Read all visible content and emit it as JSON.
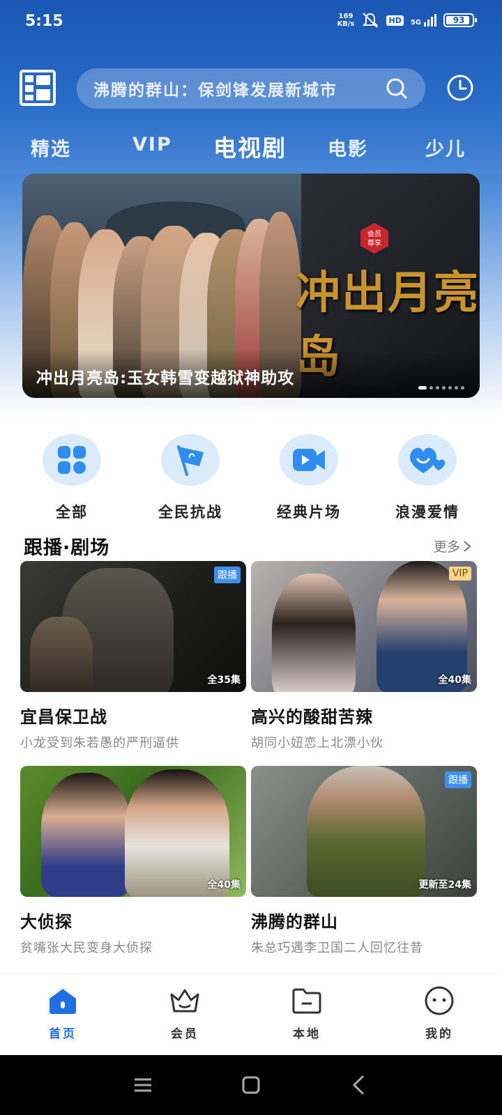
{
  "status_bar": {
    "time": "5:15",
    "speed_value": "169",
    "speed_unit": "KB/s",
    "hd": "HD",
    "network": "5G",
    "battery": "93",
    "battery_level": 0.93
  },
  "search": {
    "placeholder": "沸腾的群山：保剑锋发展新城市",
    "icon": "search-icon"
  },
  "tabs": [
    {
      "label": "精选",
      "active": false
    },
    {
      "label": "VIP",
      "active": false
    },
    {
      "label": "电视剧",
      "active": true
    },
    {
      "label": "电影",
      "active": false
    },
    {
      "label": "少儿",
      "active": false
    }
  ],
  "banner": {
    "art_title": "冲出月亮岛",
    "seal_text_1": "会员",
    "seal_text_2": "尊享",
    "caption": "冲出月亮岛:玉女韩雪变越狱神助攻",
    "dot_count": 7,
    "active_dot": 0
  },
  "categories": [
    {
      "label": "全部",
      "icon": "grid-icon"
    },
    {
      "label": "全民抗战",
      "icon": "flag-icon"
    },
    {
      "label": "经典片场",
      "icon": "video-camera-icon"
    },
    {
      "label": "浪漫爱情",
      "icon": "heart-icon"
    }
  ],
  "section": {
    "title": "跟播·剧场",
    "more": "更多"
  },
  "cards": [
    {
      "title": "宜昌保卫战",
      "subtitle": "小龙受到朱若愚的严刑逼供",
      "badge": "跟播",
      "episodes": "全35集"
    },
    {
      "title": "高兴的酸甜苦辣",
      "subtitle": "胡同小妞恋上北漂小伙",
      "badge": "VIP",
      "episodes": "全40集"
    },
    {
      "title": "大侦探",
      "subtitle": "贫嘴张大民变身大侦探",
      "badge": "",
      "episodes": "全40集"
    },
    {
      "title": "沸腾的群山",
      "subtitle": "朱总巧遇李卫国二人回忆往昔",
      "badge": "跟播",
      "episodes": "更新至24集"
    }
  ],
  "bottom_nav": [
    {
      "label": "首页",
      "icon": "home-icon",
      "active": true
    },
    {
      "label": "会员",
      "icon": "crown-icon",
      "active": false
    },
    {
      "label": "本地",
      "icon": "folder-icon",
      "active": false
    },
    {
      "label": "我的",
      "icon": "profile-icon",
      "active": false
    }
  ],
  "colors": {
    "brand_blue": "#1a56b4",
    "active_blue": "#1e6fe0",
    "badge_blue": "#3e8ff0",
    "vip_gold": "#f7d58a"
  }
}
